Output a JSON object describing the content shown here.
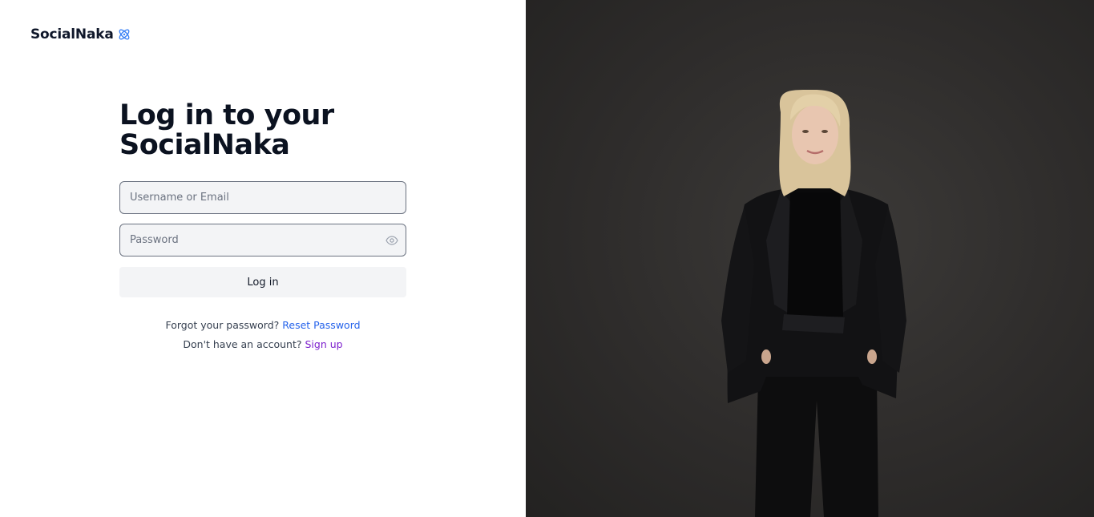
{
  "brand": {
    "name": "SocialNaka",
    "icon": "atom-icon",
    "icon_color": "#3b82f6"
  },
  "login": {
    "title": "Log in to your SocialNaka",
    "username_placeholder": "Username or Email",
    "password_placeholder": "Password",
    "password_toggle_icon": "eye-icon",
    "submit_label": "Log in"
  },
  "links": {
    "forgot_text": "Forgot your password?",
    "reset_label": "Reset Password",
    "no_account_text": "Don't have an account?",
    "signup_label": "Sign up"
  },
  "colors": {
    "link_blue": "#2563eb",
    "link_purple": "#7e22ce",
    "panel_dark": "#2e2c2b"
  }
}
